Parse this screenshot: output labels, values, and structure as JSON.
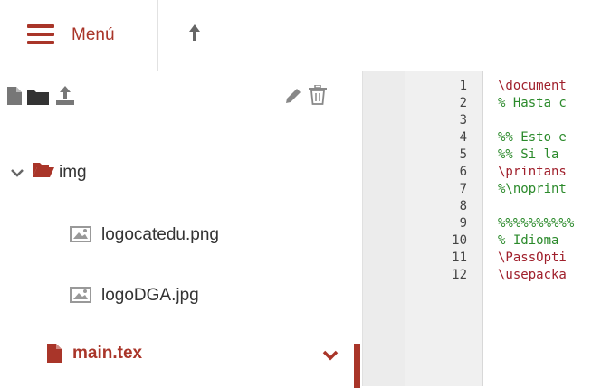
{
  "header": {
    "menu_label": "Menú",
    "menu_icon": "hamburger-icon",
    "up_icon": "up-arrow-icon"
  },
  "sidebar": {
    "toolbar_icons": [
      "new-file-icon",
      "new-folder-icon",
      "upload-icon",
      "rename-pencil-icon",
      "delete-trash-icon"
    ],
    "tree": [
      {
        "label": "img",
        "type": "folder",
        "expanded": true
      },
      {
        "label": "logocatedu.png",
        "type": "image"
      },
      {
        "label": "logoDGA.jpg",
        "type": "image"
      },
      {
        "label": "main.tex",
        "type": "file",
        "selected": true
      }
    ]
  },
  "editor": {
    "lines": [
      {
        "no": "1",
        "text": "\\document",
        "kind": "cmd"
      },
      {
        "no": "2",
        "text": "% Hasta c",
        "kind": "com"
      },
      {
        "no": "3",
        "text": "",
        "kind": "com"
      },
      {
        "no": "4",
        "text": "%% Esto e",
        "kind": "com"
      },
      {
        "no": "5",
        "text": "%% Si la ",
        "kind": "com"
      },
      {
        "no": "6",
        "text": "\\printans",
        "kind": "cmd"
      },
      {
        "no": "7",
        "text": "%\\noprint",
        "kind": "com"
      },
      {
        "no": "8",
        "text": "",
        "kind": "com"
      },
      {
        "no": "9",
        "text": "%%%%%%%%%%",
        "kind": "com"
      },
      {
        "no": "10",
        "text": "% Idioma ",
        "kind": "com"
      },
      {
        "no": "11",
        "text": "\\PassOpti",
        "kind": "cmd"
      },
      {
        "no": "12",
        "text": "\\usepacka",
        "kind": "cmd"
      }
    ]
  },
  "colors": {
    "accent": "#a93529",
    "comment": "#2b8a2b",
    "command": "#a0202c"
  }
}
